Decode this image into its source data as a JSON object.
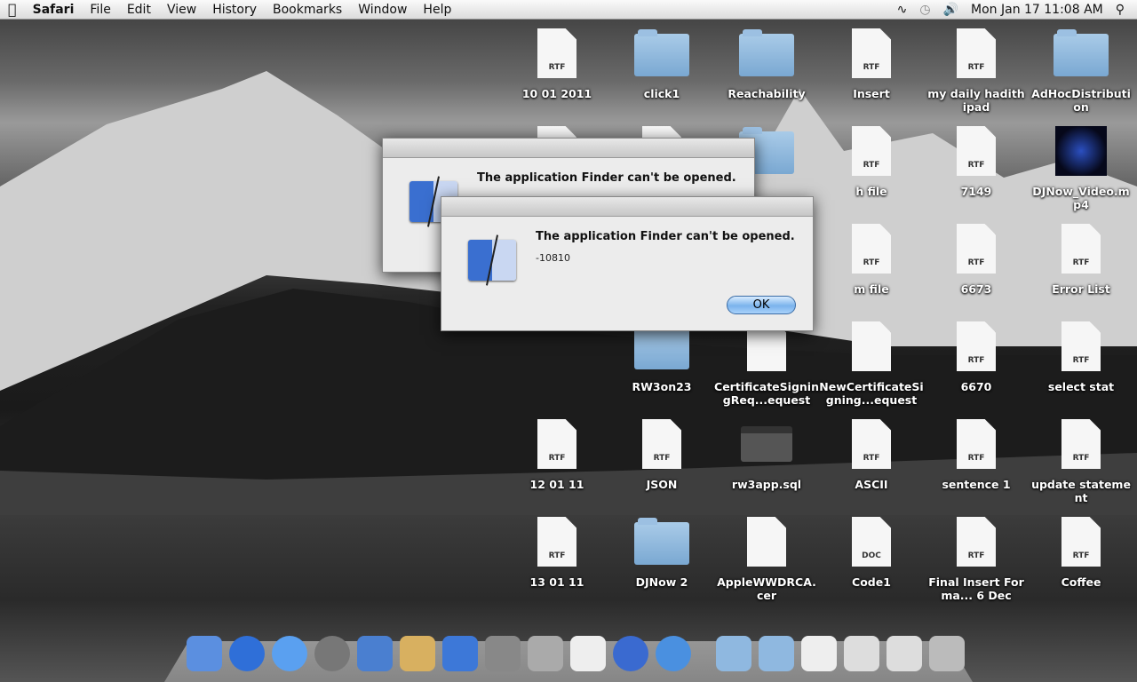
{
  "menubar": {
    "apple": "",
    "app": "Safari",
    "items": [
      "File",
      "Edit",
      "View",
      "History",
      "Bookmarks",
      "Window",
      "Help"
    ],
    "clock": "Mon Jan 17  11:08 AM"
  },
  "desktop": [
    {
      "label": "10 01 2011",
      "type": "rtf",
      "col": 0,
      "row": 0
    },
    {
      "label": "click1",
      "type": "folder",
      "col": 1,
      "row": 0
    },
    {
      "label": "Reachability",
      "type": "folder",
      "col": 2,
      "row": 0
    },
    {
      "label": "Insert",
      "type": "rtf",
      "col": 3,
      "row": 0
    },
    {
      "label": "my daily hadith ipad",
      "type": "rtf",
      "col": 4,
      "row": 0
    },
    {
      "label": "AdHocDistribution",
      "type": "folder",
      "col": 5,
      "row": 0
    },
    {
      "label": "h file",
      "type": "rtf",
      "col": 3,
      "row": 1
    },
    {
      "label": "7149",
      "type": "rtf",
      "col": 4,
      "row": 1
    },
    {
      "label": "DJNow_Video.mp4",
      "type": "video",
      "col": 5,
      "row": 1
    },
    {
      "label": "m file",
      "type": "rtf",
      "col": 3,
      "row": 2
    },
    {
      "label": "6673",
      "type": "rtf",
      "col": 4,
      "row": 2
    },
    {
      "label": "Error List",
      "type": "rtf",
      "col": 5,
      "row": 2
    },
    {
      "label": "RW3on23",
      "type": "folder",
      "col": 1,
      "row": 3
    },
    {
      "label": "CertificateSigningReq...equest",
      "type": "blank",
      "col": 2,
      "row": 3
    },
    {
      "label": "NewCertificateSigning...equest",
      "type": "blank",
      "col": 3,
      "row": 3
    },
    {
      "label": "6670",
      "type": "rtf",
      "col": 4,
      "row": 3
    },
    {
      "label": "select stat",
      "type": "rtf",
      "col": 5,
      "row": 3
    },
    {
      "label": "12 01 11",
      "type": "rtf",
      "col": 0,
      "row": 4
    },
    {
      "label": "JSON",
      "type": "rtf",
      "col": 1,
      "row": 4
    },
    {
      "label": "rw3app.sql",
      "type": "term",
      "col": 2,
      "row": 4
    },
    {
      "label": "ASCII",
      "type": "rtf",
      "col": 3,
      "row": 4
    },
    {
      "label": "sentence 1",
      "type": "rtf",
      "col": 4,
      "row": 4
    },
    {
      "label": "update statement",
      "type": "rtf",
      "col": 5,
      "row": 4
    },
    {
      "label": "13 01 11",
      "type": "rtf",
      "col": 0,
      "row": 5
    },
    {
      "label": "DJNow 2",
      "type": "folder",
      "col": 1,
      "row": 5
    },
    {
      "label": "AppleWWDRCA.cer",
      "type": "blank",
      "col": 2,
      "row": 5
    },
    {
      "label": "Code1",
      "type": "doc",
      "col": 3,
      "row": 5
    },
    {
      "label": "Final Insert Forma... 6 Dec",
      "type": "rtf",
      "col": 4,
      "row": 5
    },
    {
      "label": "Coffee",
      "type": "rtf",
      "col": 5,
      "row": 5
    }
  ],
  "doc_badges": {
    "rtf": "RTF",
    "doc": "DOC"
  },
  "dialogs": [
    {
      "title": "The application Finder can't be opened."
    },
    {
      "title": "The application Finder can't be opened.",
      "code": "-10810",
      "ok": "OK"
    }
  ],
  "dock": [
    "finder",
    "app-store",
    "ichat",
    "time-machine",
    "xcode",
    "instruments",
    "ios-simulator",
    "system-preferences",
    "help",
    "textedit",
    "sync",
    "safari",
    "documents-stack",
    "applications-stack",
    "provisioning-file",
    "preview-window",
    "window-stack",
    "trash"
  ]
}
